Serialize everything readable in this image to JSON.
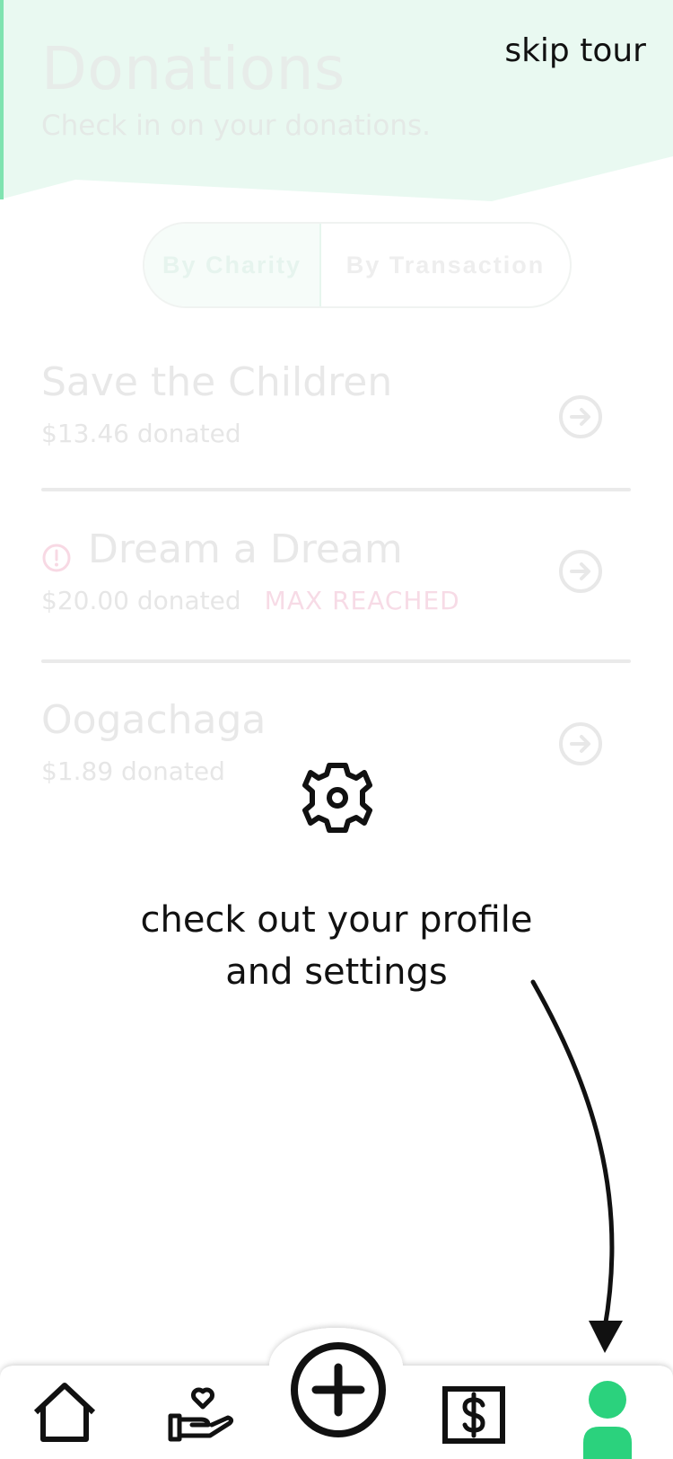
{
  "header": {
    "title": "Donations",
    "subtitle": "Check in on your donations.",
    "skip_label": "skip tour"
  },
  "toggle": {
    "options": [
      "By Charity",
      "By Transaction"
    ],
    "selected": "By Charity"
  },
  "donations": [
    {
      "name": "Save the Children",
      "amount": "$13.46 donated",
      "badge": ""
    },
    {
      "name": "Dream a Dream",
      "amount": "$20.00 donated",
      "badge": "MAX REACHED",
      "warning": true
    },
    {
      "name": "Oogachaga",
      "amount": "$1.89 donated",
      "badge": ""
    }
  ],
  "tour": {
    "icon": "gear-icon",
    "line1": "check out your profile",
    "line2": "and settings"
  },
  "nav": {
    "items": [
      "home-icon",
      "donate-hand-heart-icon",
      "add-circle-icon",
      "dollar-icon",
      "profile-icon"
    ],
    "active": "profile-icon"
  },
  "colors": {
    "accent": "#2bd27d",
    "header_tint": "#e9f9f1",
    "max_reached": "#f7dbe6",
    "text_dark": "#111111"
  }
}
